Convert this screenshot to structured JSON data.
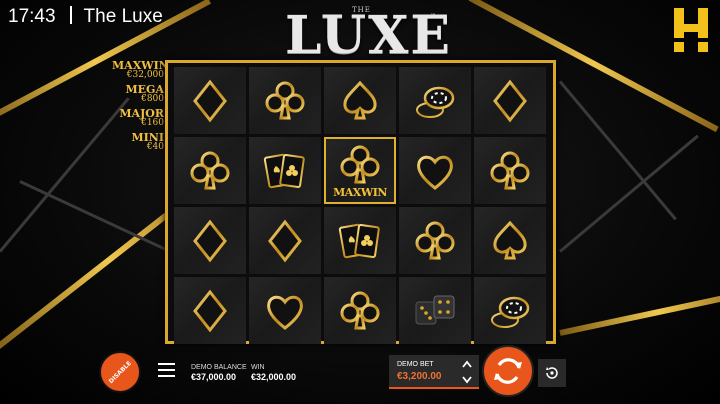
{
  "status_bar": {
    "time": "17:43",
    "title": "The Luxe"
  },
  "logo": {
    "small": "THE",
    "main": "LUXE",
    "tm": "™"
  },
  "jackpots": [
    {
      "name": "MAXWIN",
      "value": "€32,000"
    },
    {
      "name": "MEGA",
      "value": "€800"
    },
    {
      "name": "MAJOR",
      "value": "€160"
    },
    {
      "name": "MINI",
      "value": "€40"
    }
  ],
  "reels": [
    [
      "diamond",
      "club",
      "spade",
      "chips",
      "diamond"
    ],
    [
      "club",
      "cards",
      "club",
      "heart",
      "club"
    ],
    [
      "diamond",
      "diamond",
      "cards",
      "club",
      "spade"
    ],
    [
      "diamond",
      "heart",
      "club",
      "dice",
      "chips"
    ]
  ],
  "highlight": {
    "label": "MAXWIN"
  },
  "bottom_bar": {
    "disable_label": "DISABLE",
    "balance_label": "DEMO BALANCE",
    "balance_value": "€37,000.00",
    "win_label": "WIN",
    "win_value": "€32,000.00",
    "bet_label": "DEMO BET",
    "bet_value": "€3,200.00"
  },
  "colors": {
    "gold": "#d9a82c",
    "accent": "#e8561b",
    "jackpot": "#f0c040"
  },
  "icons": [
    "menu-icon",
    "chevron-up-icon",
    "chevron-down-icon",
    "spin-icon",
    "autoplay-icon",
    "brand-logo-icon"
  ]
}
